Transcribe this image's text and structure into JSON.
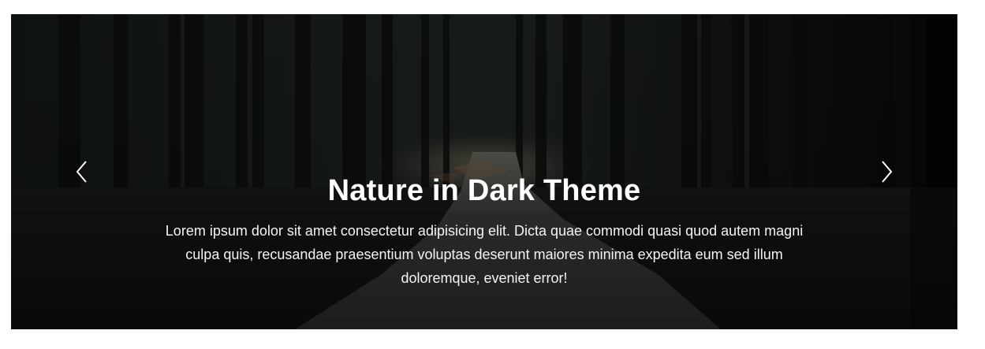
{
  "carousel": {
    "slide": {
      "image": "dark-forest-road-photo",
      "title": "Nature in Dark Theme",
      "text": "Lorem ipsum dolor sit amet consectetur adipisicing elit. Dicta quae commodi quasi quod autem magni culpa quis, recusandae praesentium voluptas deserunt maiores minima expedita eum sed illum doloremque, eveniet error!"
    },
    "controls": {
      "prev_icon": "chevron-left-icon",
      "next_icon": "chevron-right-icon"
    }
  }
}
